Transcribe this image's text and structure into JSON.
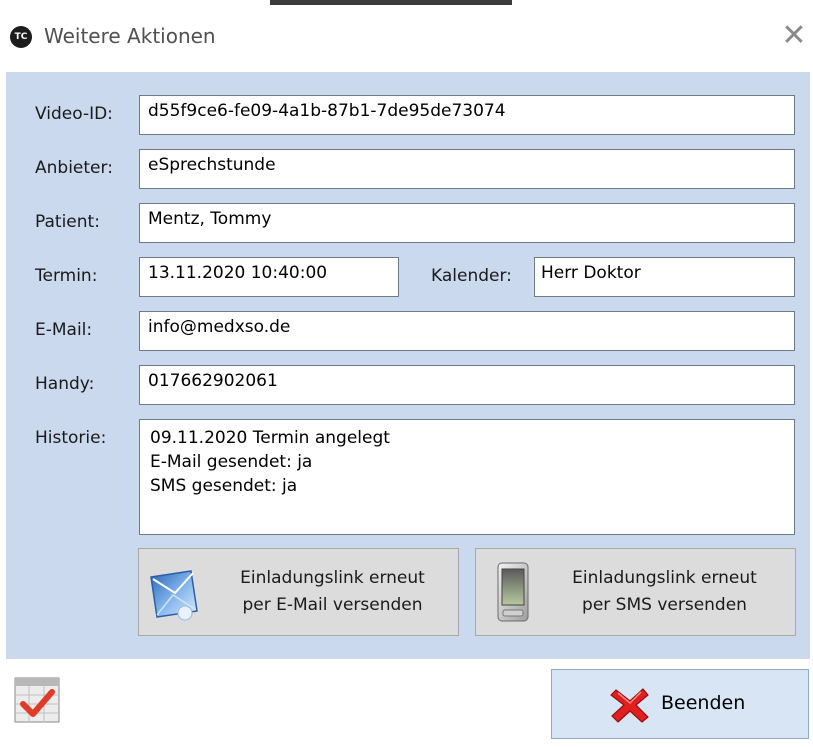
{
  "window": {
    "title": "Weitere Aktionen",
    "app_icon_text": "TC",
    "close_symbol": "✕"
  },
  "form": {
    "video_id": {
      "label": "Video-ID:",
      "value": "d55f9ce6-fe09-4a1b-87b1-7de95de73074"
    },
    "anbieter": {
      "label": "Anbieter:",
      "value": "eSprechstunde"
    },
    "patient": {
      "label": "Patient:",
      "value": "Mentz, Tommy"
    },
    "termin": {
      "label": "Termin:",
      "value": "13.11.2020 10:40:00"
    },
    "kalender": {
      "label": "Kalender:",
      "value": "Herr Doktor"
    },
    "email": {
      "label": "E-Mail:",
      "value": "info@medxso.de"
    },
    "handy": {
      "label": "Handy:",
      "value": "017662902061"
    },
    "historie": {
      "label": "Historie:",
      "lines": [
        "09.11.2020 Termin angelegt",
        "E-Mail gesendet: ja",
        "SMS gesendet: ja"
      ]
    }
  },
  "actions": {
    "email_button": {
      "line1": "Einladungslink erneut",
      "line2": "per  E-Mail versenden",
      "icon": "mail-icon"
    },
    "sms_button": {
      "line1": "Einladungslink erneut",
      "line2": "per SMS versenden",
      "icon": "phone-icon"
    }
  },
  "footer": {
    "check_icon": "checklist-icon",
    "end_button": {
      "label": "Beenden",
      "icon": "red-x-icon"
    }
  },
  "colors": {
    "panel_bg": "#cad9ee",
    "end_button_bg": "#d7e5f5",
    "action_button_bg": "#dcdcdc",
    "accent_red": "#e02020"
  }
}
